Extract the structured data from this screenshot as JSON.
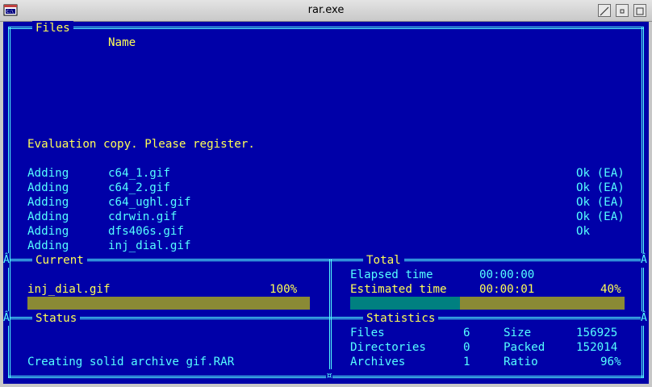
{
  "window": {
    "title": "rar.exe",
    "icon": "console-icon"
  },
  "files_panel": {
    "label": "Files",
    "column_header": "Name",
    "notice": "Evaluation copy. Please register.",
    "rows": [
      {
        "action": "Adding",
        "file": "c64_1.gif",
        "status": "Ok (EA)"
      },
      {
        "action": "Adding",
        "file": "c64_2.gif",
        "status": "Ok (EA)"
      },
      {
        "action": "Adding",
        "file": "c64_ughl.gif",
        "status": "Ok (EA)"
      },
      {
        "action": "Adding",
        "file": "cdrwin.gif",
        "status": "Ok (EA)"
      },
      {
        "action": "Adding",
        "file": "dfs406s.gif",
        "status": "Ok"
      },
      {
        "action": "Adding",
        "file": "inj_dial.gif",
        "status": ""
      }
    ]
  },
  "current_panel": {
    "label": "Current",
    "file": "inj_dial.gif",
    "percent": "100%",
    "progress": 1.0
  },
  "total_panel": {
    "label": "Total",
    "elapsed_label": "Elapsed time",
    "elapsed_value": "00:00:00",
    "estimated_label": "Estimated time",
    "estimated_value": "00:00:01",
    "percent": "40%",
    "progress": 0.4
  },
  "status_panel": {
    "label": "Status",
    "message": "Creating solid archive gif.RAR"
  },
  "statistics_panel": {
    "label": "Statistics",
    "files_label": "Files",
    "files_value": "6",
    "size_label": "Size",
    "size_value": "156925",
    "directories_label": "Directories",
    "directories_value": "0",
    "packed_label": "Packed",
    "packed_value": "152014",
    "archives_label": "Archives",
    "archives_value": "1",
    "ratio_label": "Ratio",
    "ratio_value": "96%"
  },
  "colors": {
    "background": "#0000a8",
    "text": "#55ffff",
    "highlight": "#ffff55",
    "progress_fill": "#008080",
    "progress_track": "#8a8a35"
  }
}
